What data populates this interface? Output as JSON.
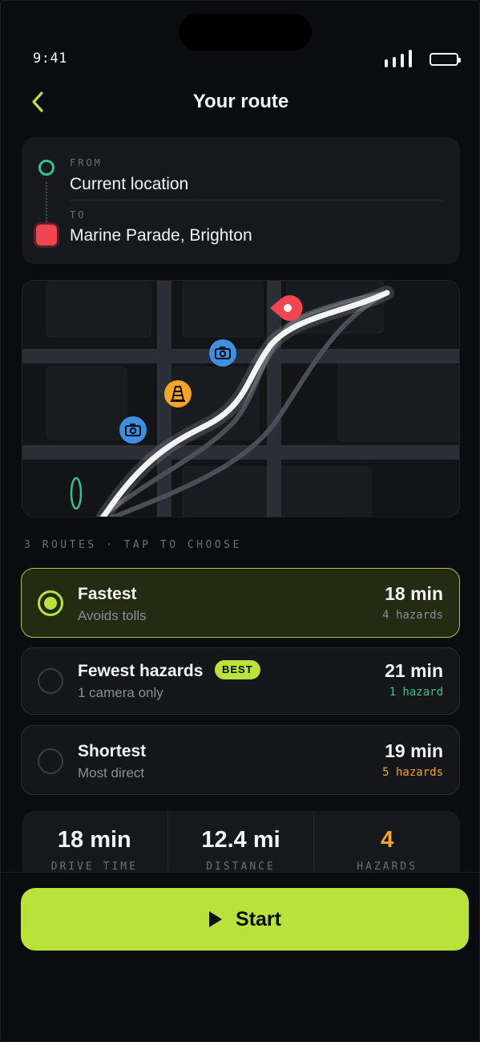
{
  "status": {
    "time": "9:41"
  },
  "header": {
    "title": "Your route"
  },
  "locations": {
    "from_label": "FROM",
    "from_value": "Current location",
    "to_label": "TO",
    "to_value": "Marine Parade, Brighton"
  },
  "routes": {
    "header": "3 ROUTES · TAP TO CHOOSE",
    "items": [
      {
        "name": "Fastest",
        "subtitle": "Avoids tolls",
        "time": "18 min",
        "hazards": "4 hazards",
        "hazard_color": "#8a8f98",
        "selected": true
      },
      {
        "name": "Fewest hazards",
        "subtitle": "1 camera only",
        "time": "21 min",
        "hazards": "1 hazard",
        "hazard_color": "#35c28c",
        "badge": "BEST",
        "selected": false
      },
      {
        "name": "Shortest",
        "subtitle": "Most direct",
        "time": "19 min",
        "hazards": "5 hazards",
        "hazard_color": "#f5a524",
        "selected": false
      }
    ]
  },
  "stats": [
    {
      "value": "18 min",
      "label": "DRIVE TIME",
      "color": "#f2f3f5"
    },
    {
      "value": "12.4 mi",
      "label": "DISTANCE",
      "color": "#f2f3f5"
    },
    {
      "value": "4",
      "label": "HAZARDS",
      "color": "#f5a524"
    }
  ],
  "start_button": {
    "label": "Start"
  },
  "colors": {
    "accent": "#b9e23a",
    "from": "#35c28c",
    "to": "#f0464f",
    "camera": "#3d8fe0",
    "hazard": "#f5a524"
  },
  "icons": [
    "back-chevron-icon",
    "camera-icon",
    "traffic-cone-icon",
    "destination-pin-icon",
    "play-icon"
  ]
}
